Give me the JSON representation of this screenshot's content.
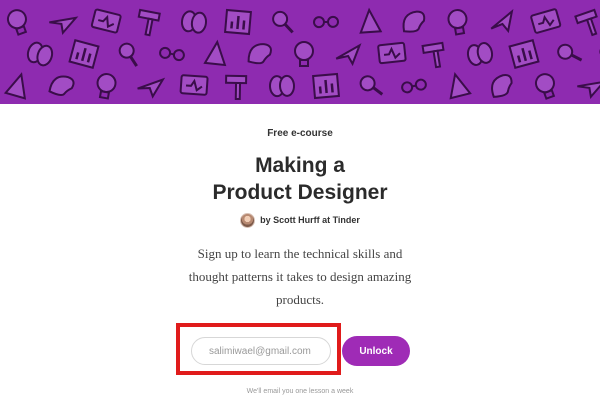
{
  "hero": {
    "background_color": "#8e2bb0",
    "pattern_icons": [
      "lightbulb-icon",
      "paper-plane-icon",
      "monitor-icon",
      "hammer-icon",
      "brain-icon",
      "chart-icon",
      "magnifier-icon",
      "glasses-icon",
      "pen-tool-icon",
      "palette-icon"
    ]
  },
  "course": {
    "eyebrow": "Free e-course",
    "title_line1": "Making a",
    "title_line2": "Product Designer",
    "byline": "by Scott Hurff at Tinder",
    "description": "Sign up to learn the technical skills and thought patterns it takes to design amazing products."
  },
  "signup": {
    "email_value": "salimiwael@gmail.com",
    "email_placeholder": "salimiwael@gmail.com",
    "unlock_label": "Unlock",
    "accent_color": "#9f2bb6",
    "note": "We'll email you one lesson a week"
  },
  "annotation": {
    "highlight_color": "#e01b1b"
  }
}
